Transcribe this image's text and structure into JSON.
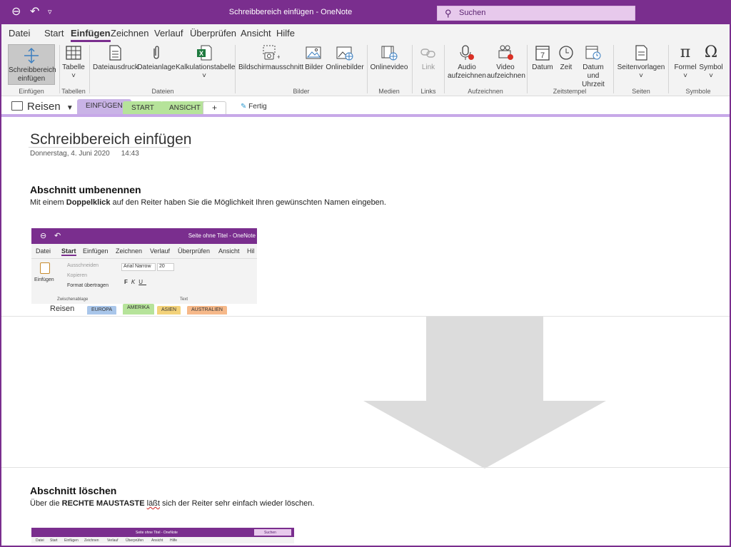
{
  "window": {
    "title": "Schreibbereich einfügen  -  OneNote",
    "search_placeholder": "Suchen",
    "accent": "#7a2e8e"
  },
  "menu": [
    "Datei",
    "Start",
    "Einfügen",
    "Zeichnen",
    "Verlauf",
    "Überprüfen",
    "Ansicht",
    "Hilfe"
  ],
  "active_menu": "Einfügen",
  "ribbon": {
    "buttons": {
      "schreibbereich": "Schreibbereich einfügen",
      "tabelle": "Tabelle",
      "dateiausdruck": "Dateiausdruck",
      "dateianlage": "Dateianlage",
      "kalkulation": "Kalkulationstabelle",
      "bildschirm": "Bildschirmausschnitt",
      "bilder": "Bilder",
      "onlinebilder": "Onlinebilder",
      "onlinevideo": "Onlinevideo",
      "link": "Link",
      "audio": "Audio aufzeichnen",
      "video": "Video aufzeichnen",
      "datum": "Datum",
      "zeit": "Zeit",
      "datum_uhrzeit": "Datum und Uhrzeit",
      "seitenvorlagen": "Seitenvorlagen",
      "formel": "Formel",
      "symbol": "Symbol"
    },
    "groups": {
      "einfuegen": "Einfügen",
      "tabellen": "Tabellen",
      "dateien": "Dateien",
      "bilder": "Bilder",
      "medien": "Medien",
      "links": "Links",
      "aufzeichnen": "Aufzeichnen",
      "zeitstempel": "Zeitstempel",
      "seiten": "Seiten",
      "symbole": "Symbole"
    }
  },
  "notebook": {
    "name": "Reisen",
    "sections": [
      {
        "label": "EINFÜGEN",
        "color": "#c9b3e6"
      },
      {
        "label": "START",
        "color": "#b6e39a"
      },
      {
        "label": "ANSICHT",
        "color": "#b6e39a"
      }
    ],
    "add_tab": "+",
    "status": "Fertig"
  },
  "page": {
    "title": "Schreibbereich einfügen",
    "date": "Donnerstag, 4. Juni 2020",
    "time": "14:43",
    "heading1": "Abschnitt umbenennen",
    "text1_pre": "Mit einem ",
    "text1_bold": "Doppelklick",
    "text1_post": " auf den Reiter haben Sie die Möglichkeit Ihren gewünschten Namen eingeben.",
    "heading2": "Abschnitt löschen",
    "text2_pre": "Über die ",
    "text2_bold": "RECHTE MAUSTASTE",
    "text2_misspelled": "läßt",
    "text2_post": " sich der Reiter sehr einfach wieder löschen."
  },
  "embedded1": {
    "title": "Seite ohne Titel  -  OneNote",
    "menu": [
      "Datei",
      "Start",
      "Einfügen",
      "Zeichnen",
      "Verlauf",
      "Überprüfen",
      "Ansicht",
      "Hil"
    ],
    "ribbon": {
      "paste": "Einfügen",
      "cut": "Ausschneiden",
      "copy": "Kopieren",
      "format": "Format übertragen",
      "font": "Arial Narrow",
      "size": "20",
      "group_clipboard": "Zwischenablage",
      "group_text": "Text"
    },
    "notebook": "Reisen",
    "sections": [
      {
        "label": "EUROPA",
        "color": "#a9c6ea"
      },
      {
        "label": "AMERIKA",
        "color": "#b6e39a"
      },
      {
        "label": "ASIEN",
        "color": "#f3d27a"
      },
      {
        "label": "AUSTRALIEN",
        "color": "#f6b98a"
      }
    ]
  },
  "embedded2": {
    "title": "Seite ohne Titel  -  OneNote",
    "search": "Suchen",
    "menu": [
      "Datei",
      "Start",
      "Einfügen",
      "Zeichnen",
      "Verlauf",
      "Überprüfen",
      "Ansicht",
      "Hilfe"
    ]
  }
}
